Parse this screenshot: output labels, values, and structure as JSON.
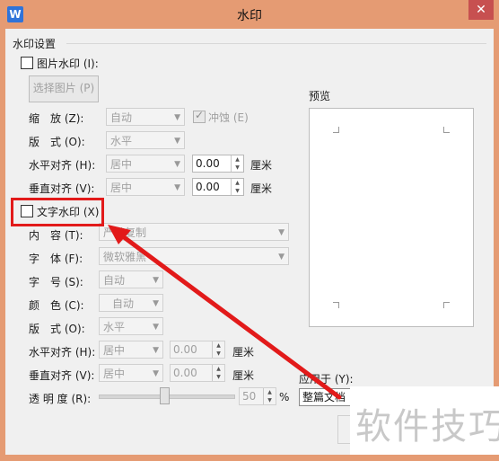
{
  "window": {
    "title": "水印",
    "app_icon_letter": "W",
    "close_glyph": "✕"
  },
  "group": {
    "title": "水印设置"
  },
  "picture": {
    "checkbox_label": "图片水印 (I):",
    "select_button": "选择图片 (P)",
    "scale_label": "缩　放 (Z):",
    "scale_value": "自动",
    "washout_label": "冲蚀 (E)",
    "layout_label": "版　式 (O):",
    "layout_value": "水平",
    "halign_label": "水平对齐 (H):",
    "halign_value": "居中",
    "halign_offset": "0.00",
    "valign_label": "垂直对齐 (V):",
    "valign_value": "居中",
    "valign_offset": "0.00",
    "unit": "厘米"
  },
  "text": {
    "checkbox_label": "文字水印 (X)",
    "content_label": "内　容 (T):",
    "content_value": "严禁复制",
    "font_label": "字　体 (F):",
    "font_value": "微软雅黑",
    "size_label": "字　号 (S):",
    "size_value": "自动",
    "color_label": "颜　色 (C):",
    "color_value": "自动",
    "layout_label": "版　式 (O):",
    "layout_value": "水平",
    "halign_label": "水平对齐 (H):",
    "halign_value": "居中",
    "halign_offset": "0.00",
    "valign_label": "垂直对齐 (V):",
    "valign_value": "居中",
    "valign_offset": "0.00",
    "unit": "厘米",
    "transparency_label": "透 明 度 (R):",
    "transparency_value": "50",
    "transparency_unit": "%"
  },
  "preview": {
    "label": "预览"
  },
  "apply": {
    "label": "应用于 (Y):",
    "value": "整篇文档"
  },
  "overlay": {
    "watermark": "软件技巧",
    "highlight_color": "#e21a1a",
    "arrow_color": "#e21a1a"
  },
  "colors": {
    "titlebar": "#e59b73",
    "close": "#c75050",
    "client": "#f0f0f0"
  }
}
